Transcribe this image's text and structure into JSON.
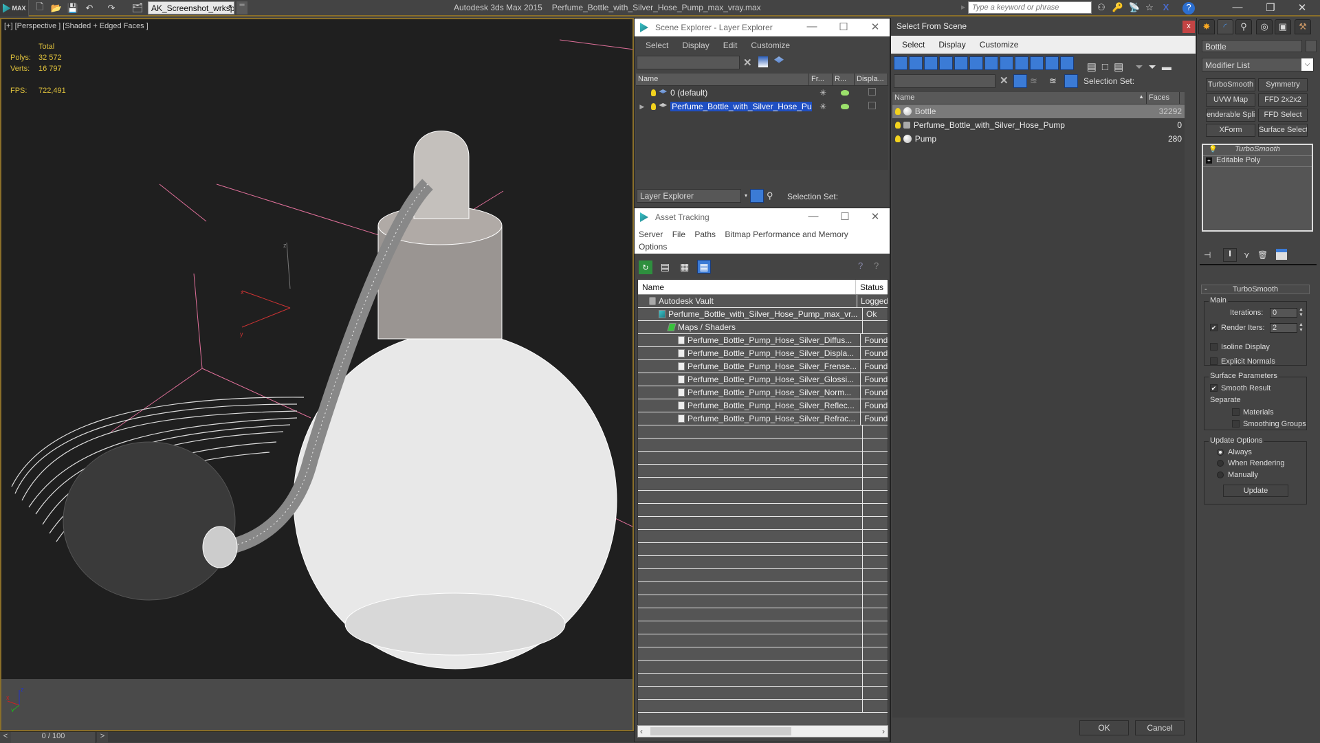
{
  "titlebar": {
    "logo_label": "MAX",
    "workspace": "AK_Screenshot_wrksp",
    "app_name": "Autodesk 3ds Max  2015",
    "file_name": "Perfume_Bottle_with_Silver_Hose_Pump_max_vray.max",
    "search_placeholder": "Type a keyword or phrase",
    "icons": [
      "new-file-icon",
      "open-file-icon",
      "save-icon",
      "undo-icon",
      "redo-icon",
      "project-folder-icon"
    ],
    "help_icons": [
      "binoculars-icon",
      "key-icon",
      "satellite-icon",
      "star-icon",
      "x-icon",
      "help-icon"
    ],
    "window_controls": {
      "minimize": "—",
      "maximize": "❐",
      "close": "✕"
    }
  },
  "viewport": {
    "label": "[+] [Perspective ] [Shaded + Edged Faces ]",
    "stats": {
      "header": "Total",
      "polys_label": "Polys:",
      "polys_value": "32 572",
      "verts_label": "Verts:",
      "verts_value": "16 797",
      "fps_label": "FPS:",
      "fps_value": "722,491"
    },
    "axis": {
      "x": "x",
      "y": "y",
      "z": "z"
    }
  },
  "timeline": {
    "prev": "<",
    "frame": "0 / 100",
    "next": ">"
  },
  "scene_explorer": {
    "title": "Scene Explorer - Layer Explorer",
    "menu": [
      "Select",
      "Display",
      "Edit",
      "Customize"
    ],
    "columns": [
      "Name",
      "Fr...",
      "R...",
      "Displa..."
    ],
    "rows": [
      {
        "name": "0 (default)",
        "selected": false
      },
      {
        "name": "Perfume_Bottle_with_Silver_Hose_Pu...",
        "selected": true
      }
    ],
    "footer_dropdown": "Layer Explorer",
    "selection_set_label": "Selection Set:"
  },
  "asset_tracking": {
    "title": "Asset Tracking",
    "menu": [
      "Server",
      "File",
      "Paths",
      "Bitmap Performance and Memory",
      "Options"
    ],
    "columns": [
      "Name",
      "Status"
    ],
    "rows": [
      {
        "name": "Autodesk Vault",
        "status": "Logged",
        "indent": 0
      },
      {
        "name": "Perfume_Bottle_with_Silver_Hose_Pump_max_vr...",
        "status": "Ok",
        "indent": 1
      },
      {
        "name": "Maps / Shaders",
        "status": "",
        "indent": 2
      },
      {
        "name": "Perfume_Bottle_Pump_Hose_Silver_Diffus...",
        "status": "Found",
        "indent": 3
      },
      {
        "name": "Perfume_Bottle_Pump_Hose_Silver_Displa...",
        "status": "Found",
        "indent": 3
      },
      {
        "name": "Perfume_Bottle_Pump_Hose_Silver_Frense...",
        "status": "Found",
        "indent": 3
      },
      {
        "name": "Perfume_Bottle_Pump_Hose_Silver_Glossi...",
        "status": "Found",
        "indent": 3
      },
      {
        "name": "Perfume_Bottle_Pump_Hose_Silver_Norm...",
        "status": "Found",
        "indent": 3
      },
      {
        "name": "Perfume_Bottle_Pump_Hose_Silver_Reflec...",
        "status": "Found",
        "indent": 3
      },
      {
        "name": "Perfume_Bottle_Pump_Hose_Silver_Refrac...",
        "status": "Found",
        "indent": 3
      }
    ]
  },
  "select_from_scene": {
    "title": "Select From Scene",
    "close_label": "x",
    "menu": [
      "Select",
      "Display",
      "Customize"
    ],
    "selection_set_label": "Selection Set:",
    "columns": [
      "Name",
      "Faces"
    ],
    "rows": [
      {
        "name": "Bottle",
        "faces": "32292",
        "selected": true
      },
      {
        "name": "Perfume_Bottle_with_Silver_Hose_Pump",
        "faces": "0",
        "selected": false
      },
      {
        "name": "Pump",
        "faces": "280",
        "selected": false
      }
    ],
    "ok_label": "OK",
    "cancel_label": "Cancel"
  },
  "command_panel": {
    "object_name": "Bottle",
    "modifier_list": "Modifier List",
    "modifier_buttons": [
      "TurboSmooth",
      "Symmetry",
      "UVW Map",
      "FFD 2x2x2",
      "enderable Splin",
      "FFD Select",
      "XForm",
      "Surface Select"
    ],
    "stack": [
      "TurboSmooth",
      "Editable Poly"
    ],
    "rollout_title": "TurboSmooth",
    "main_group": "Main",
    "iterations_label": "Iterations:",
    "iterations_value": "0",
    "render_iters_label": "Render Iters:",
    "render_iters_value": "2",
    "render_iters_checked": true,
    "isoline_label": "Isoline Display",
    "explicit_normals_label": "Explicit Normals",
    "surface_group": "Surface Parameters",
    "smooth_result_label": "Smooth Result",
    "separate_label": "Separate",
    "materials_label": "Materials",
    "smoothing_groups_label": "Smoothing Groups",
    "update_group": "Update Options",
    "update_options": [
      "Always",
      "When Rendering",
      "Manually"
    ],
    "update_selected": "Always",
    "update_button": "Update"
  },
  "colors": {
    "accent_gold": "#8a6f2a",
    "stats_yellow": "#e0c23c",
    "selection_blue": "#1f4fc2",
    "toolbar_blue": "#3b7bd6",
    "close_red": "#c44444"
  }
}
